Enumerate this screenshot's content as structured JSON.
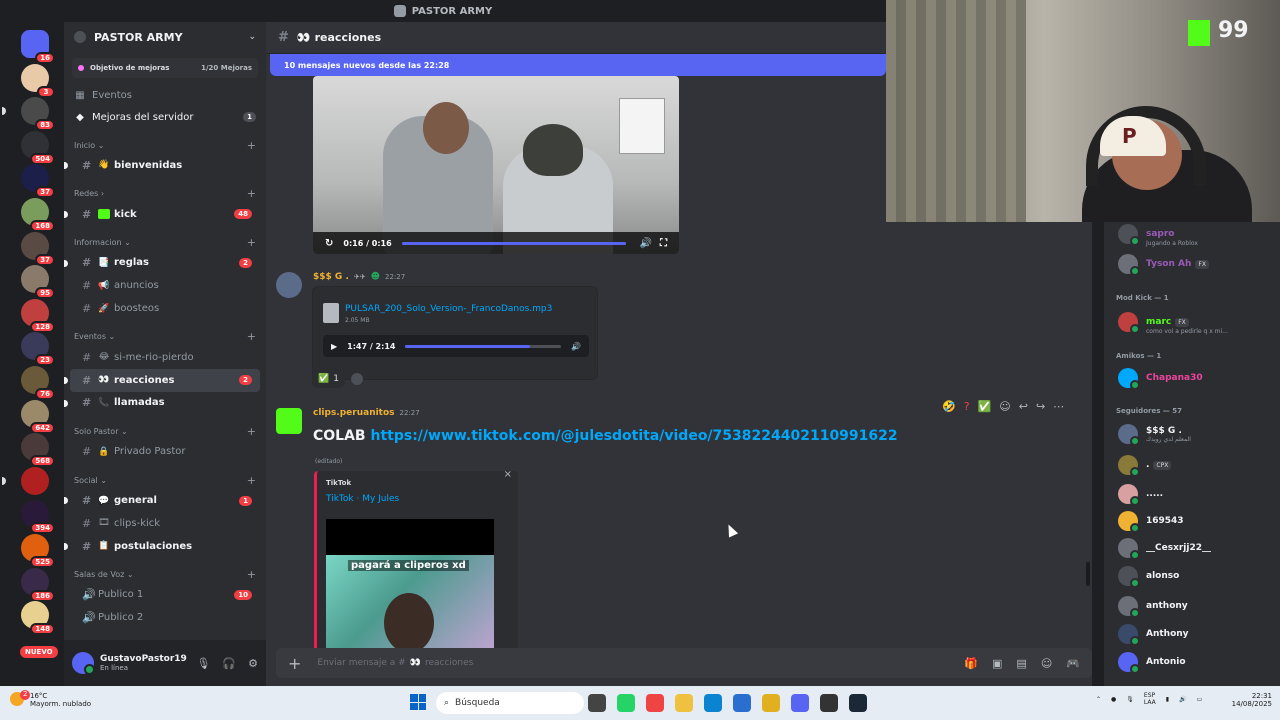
{
  "window": {
    "title": "PASTOR ARMY"
  },
  "rail": {
    "badges": [
      "16",
      "3",
      "83",
      "504",
      "37",
      "168",
      "37",
      "95",
      "128",
      "23",
      "76",
      "642",
      "568",
      "394",
      "525",
      "186",
      "148"
    ],
    "new_label": "NUEVO"
  },
  "sidebar": {
    "server_name": "PASTOR ARMY",
    "boost_goal": "Objetivo de mejoras",
    "boost_count": "1/20 Mejoras",
    "nav": [
      {
        "label": "Eventos"
      },
      {
        "label": "Mejoras del servidor",
        "count": "1"
      }
    ],
    "categories": {
      "inicio": "Inicio",
      "redes": "Redes",
      "informacion": "Informacion",
      "eventos": "Eventos",
      "solo_pastor": "Solo Pastor",
      "social": "Social",
      "salas_de_voz": "Salas de Voz"
    },
    "channels": {
      "bienvenidas": "bienvenidas",
      "kick": "kick",
      "kick_count": "48",
      "reglas": "reglas",
      "reglas_count": "2",
      "anuncios": "anuncios",
      "boosteos": "boosteos",
      "si_me_rio_pierdo": "si-me-rio-pierdo",
      "reacciones": "reacciones",
      "reacciones_count": "2",
      "llamadas": "llamadas",
      "privado_pastor": "Privado Pastor",
      "general": "general",
      "general_count": "1",
      "clips_kick": "clips-kick",
      "postulaciones": "postulaciones",
      "publico1": "Publico 1",
      "publico1_count": "10",
      "publico2": "Publico 2"
    },
    "user": {
      "name": "GustavoPastor19",
      "status": "En línea"
    }
  },
  "chat": {
    "channel": "reacciones",
    "new_messages": "10 mensajes nuevos desde las 22:28",
    "video": {
      "time": "0:16 / 0:16",
      "progress": 1.0
    },
    "msg1": {
      "author": "$$$ G .",
      "time": "22:27",
      "file_name": "PULSAR_200_Solo_Version-_FrancoDanos.mp3",
      "file_size": "2.05 MB",
      "audio_time": "1:47 / 2:14",
      "audio_progress": 0.8,
      "reaction_count": "1"
    },
    "msg2": {
      "author": "clips.peruanitos",
      "time": "22:27",
      "text": "COLAB",
      "link": "https://www.tiktok.com/@julesdotita/video/7538224402110991622",
      "edited": "(editado)",
      "embed_provider": "TikTok",
      "embed_title": "TikTok · My Jules",
      "embed_caption": "pagará a cliperos xd"
    },
    "composer_placeholder": "Enviar mensaje a #",
    "composer_channel": "reacciones"
  },
  "stream": {
    "viewer_count": "99"
  },
  "members": {
    "top": [
      {
        "name": "sapro",
        "sub": "Jugando a Roblox",
        "color": "#9b59b6"
      },
      {
        "name": "Tyson Ah",
        "sub": "",
        "color": "#9b59b6",
        "tag": "FX"
      }
    ],
    "groups": [
      {
        "label": "Mod Kick — 1"
      },
      {
        "label": "Amikos — 1"
      },
      {
        "label": "Seguidores — 57"
      }
    ],
    "mod": {
      "name": "marc",
      "tag": "FX",
      "sub": "como voi a pedirle q x mi..."
    },
    "amikos": {
      "name": "Chapana30"
    },
    "seguidores": [
      {
        "name": "$$$ G .",
        "sub": "المعلم لدي رويدك"
      },
      {
        "name": ".",
        "tag": "CPX"
      },
      {
        "name": "....."
      },
      {
        "name": "169543"
      },
      {
        "name": "__Cesxrjj22__"
      },
      {
        "name": "alonso"
      },
      {
        "name": "anthony"
      },
      {
        "name": "Anthony"
      },
      {
        "name": "Antonio"
      }
    ]
  },
  "taskbar": {
    "weather_temp": "16°C",
    "weather_text": "Mayorm. nublado",
    "weather_badge": "2",
    "search_placeholder": "Búsqueda",
    "lang": "ESP",
    "lang2": "LAA",
    "time": "22:31",
    "date": "14/08/2025"
  }
}
